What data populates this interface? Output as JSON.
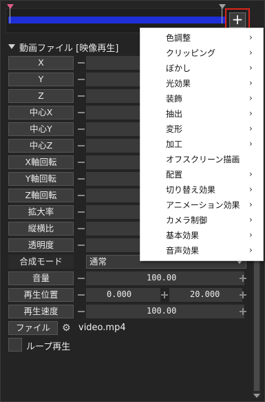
{
  "header": {
    "title": "動画ファイル [映像再生]"
  },
  "toolbar": {
    "add_label": "+"
  },
  "properties": [
    {
      "label": "X"
    },
    {
      "label": "Y"
    },
    {
      "label": "Z"
    },
    {
      "label": "中心X"
    },
    {
      "label": "中心Y"
    },
    {
      "label": "中心Z"
    },
    {
      "label": "X軸回転"
    },
    {
      "label": "Y軸回転"
    },
    {
      "label": "Z軸回転"
    },
    {
      "label": "拡大率"
    },
    {
      "label": "縦横比"
    },
    {
      "label": "透明度"
    }
  ],
  "blend": {
    "label": "合成モード",
    "value": "通常"
  },
  "volume": {
    "label": "音量",
    "value": "100.00"
  },
  "playback_position": {
    "label": "再生位置",
    "start": "0.000",
    "end": "20.000"
  },
  "playback_speed": {
    "label": "再生速度",
    "value": "100.00"
  },
  "file": {
    "label": "ファイル",
    "value": "video.mp4"
  },
  "loop": {
    "label": "ループ再生"
  },
  "menu": {
    "items": [
      {
        "label": "色調整",
        "submenu": true
      },
      {
        "label": "クリッピング",
        "submenu": true
      },
      {
        "label": "ぼかし",
        "submenu": true
      },
      {
        "label": "光効果",
        "submenu": true
      },
      {
        "label": "装飾",
        "submenu": true
      },
      {
        "label": "抽出",
        "submenu": true
      },
      {
        "label": "変形",
        "submenu": true
      },
      {
        "label": "加工",
        "submenu": true
      },
      {
        "label": "オフスクリーン描画",
        "submenu": false
      },
      {
        "label": "配置",
        "submenu": true
      },
      {
        "label": "切り替え効果",
        "submenu": true
      },
      {
        "label": "アニメーション効果",
        "submenu": true
      },
      {
        "label": "カメラ制御",
        "submenu": true
      },
      {
        "label": "基本効果",
        "submenu": true
      },
      {
        "label": "音声効果",
        "submenu": true
      }
    ],
    "arrow_glyph": "›"
  },
  "colors": {
    "timeline_bar": "#1f2fd8",
    "highlight_border": "#e0241c",
    "marker": "#e05b8a"
  }
}
